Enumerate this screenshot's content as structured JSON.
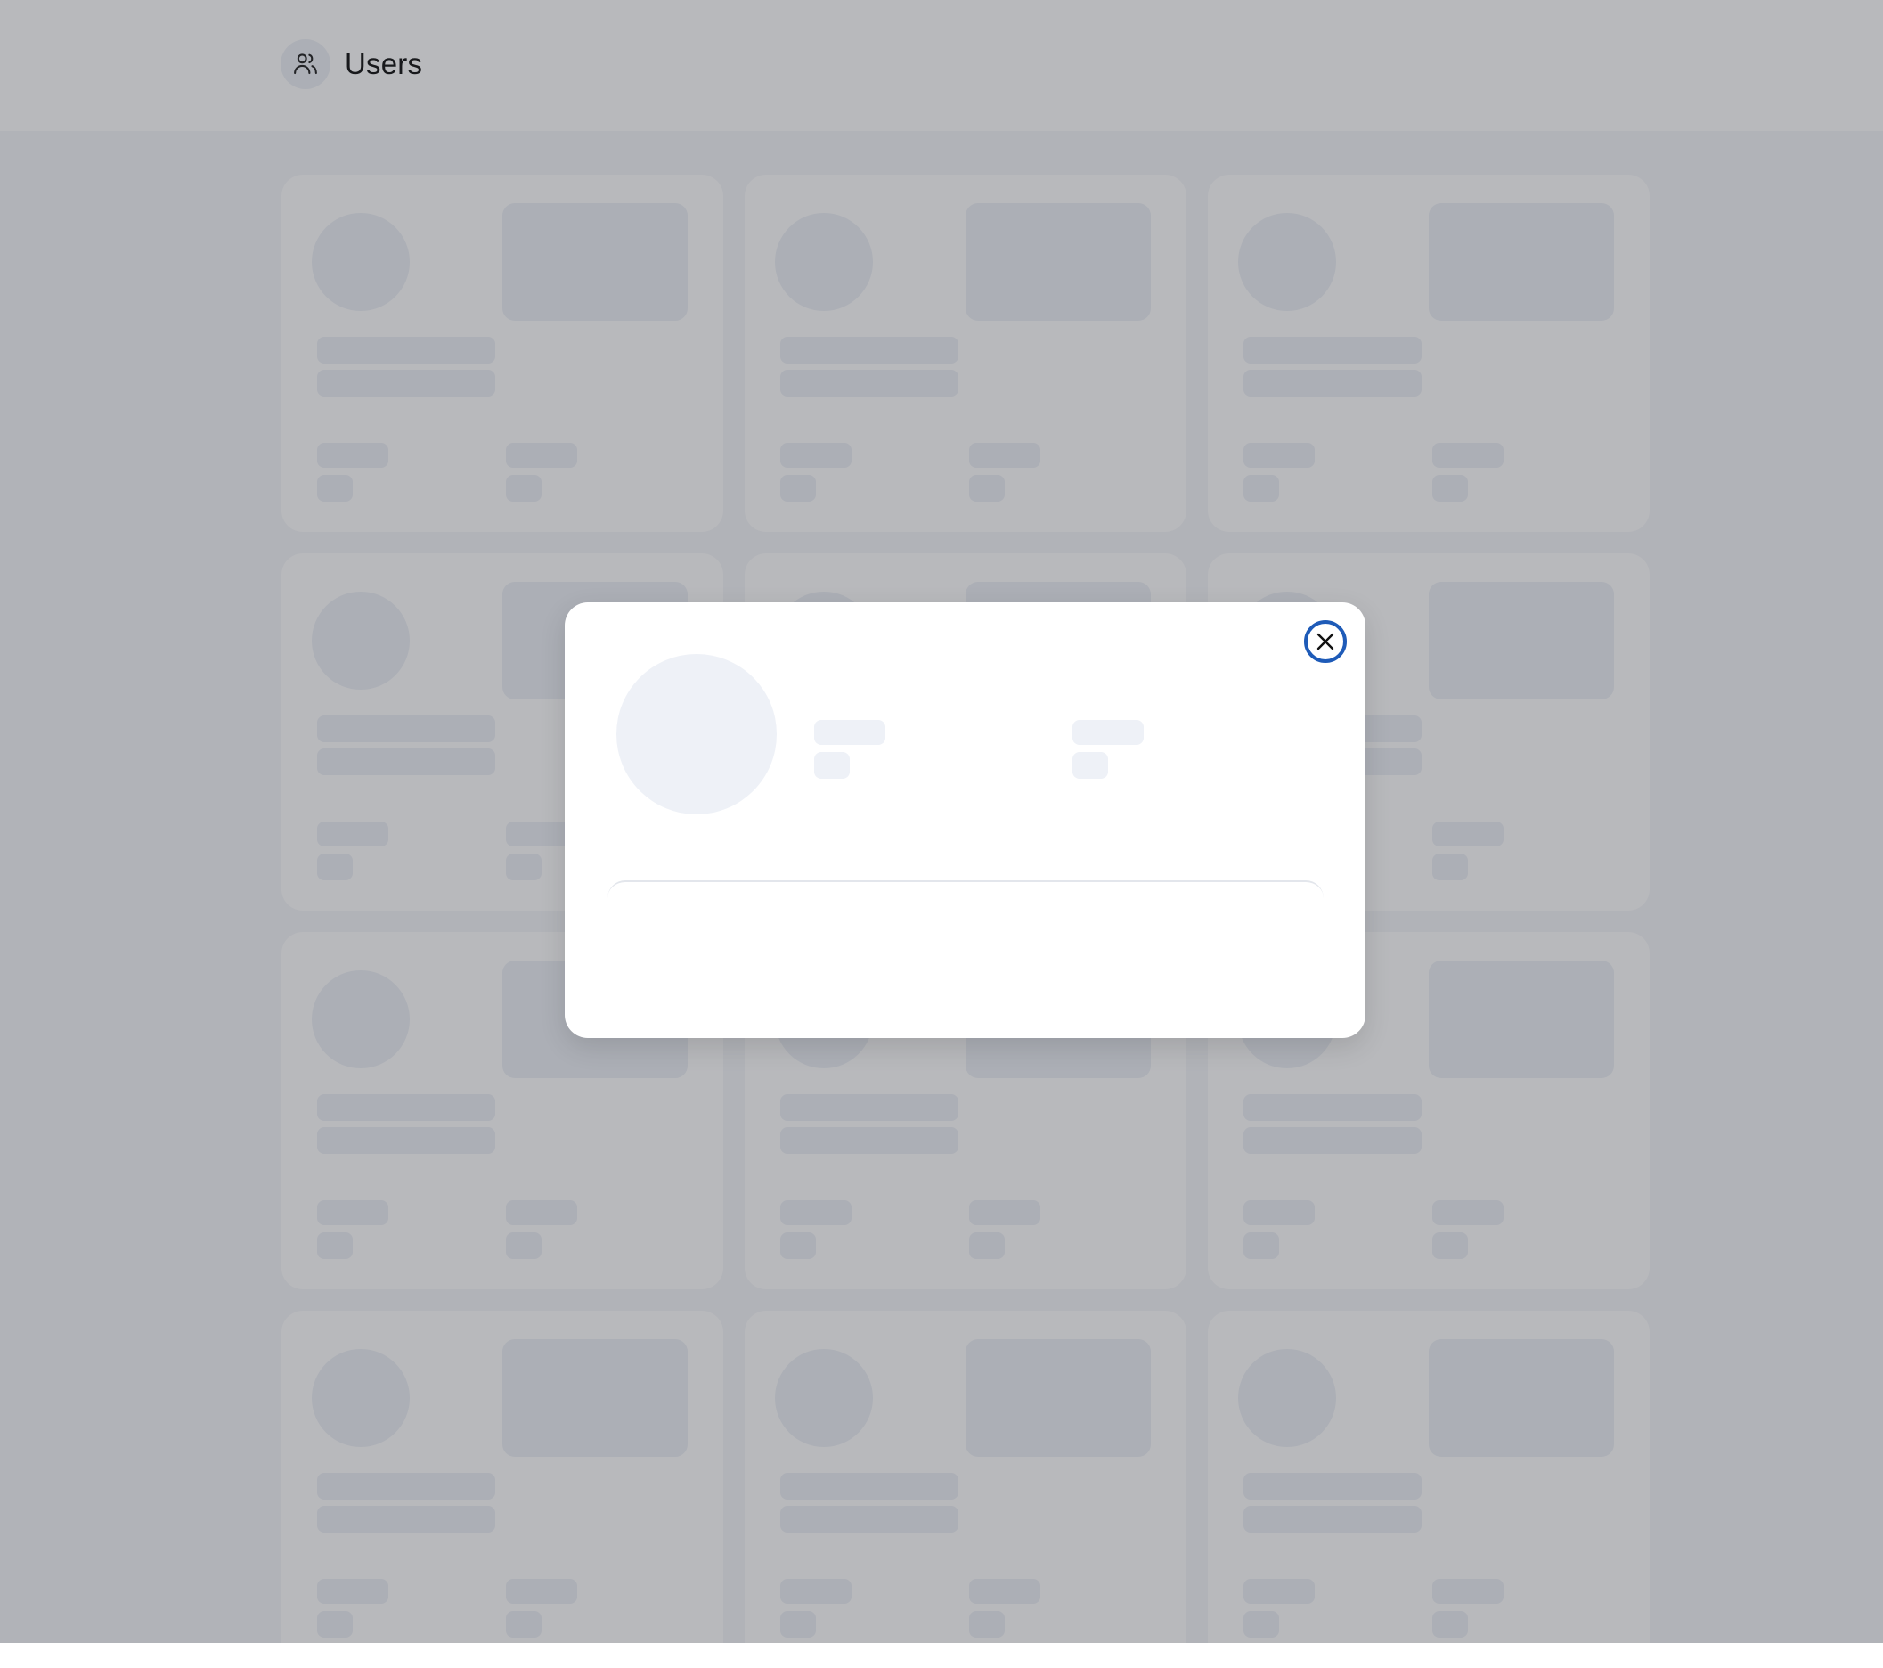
{
  "header": {
    "title": "Users",
    "icon": "users-icon"
  },
  "user_cards": {
    "count": 12,
    "state": "loading-skeleton"
  },
  "modal": {
    "state": "loading-skeleton",
    "close_icon": "close-icon",
    "accent_color": "#1e5bb8"
  },
  "colors": {
    "skeleton": "#eef1f7",
    "background": "#f5f6f9",
    "overlay": "rgba(40,44,52,0.33)"
  }
}
